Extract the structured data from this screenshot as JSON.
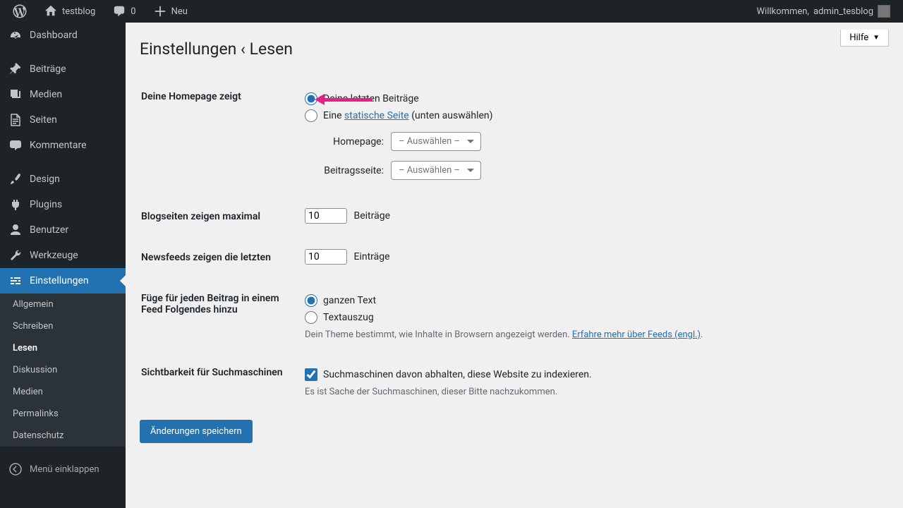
{
  "adminbar": {
    "site_name": "testblog",
    "comments_count": "0",
    "new_label": "Neu",
    "welcome_prefix": "Willkommen,",
    "username": "admin_tesblog"
  },
  "sidebar": {
    "items": [
      {
        "label": "Dashboard"
      },
      {
        "label": "Beiträge"
      },
      {
        "label": "Medien"
      },
      {
        "label": "Seiten"
      },
      {
        "label": "Kommentare"
      },
      {
        "label": "Design"
      },
      {
        "label": "Plugins"
      },
      {
        "label": "Benutzer"
      },
      {
        "label": "Werkzeuge"
      },
      {
        "label": "Einstellungen"
      }
    ],
    "submenu": [
      {
        "label": "Allgemein"
      },
      {
        "label": "Schreiben"
      },
      {
        "label": "Lesen"
      },
      {
        "label": "Diskussion"
      },
      {
        "label": "Medien"
      },
      {
        "label": "Permalinks"
      },
      {
        "label": "Datenschutz"
      }
    ],
    "collapse_label": "Menü einklappen"
  },
  "page": {
    "help_label": "Hilfe",
    "title": "Einstellungen ‹ Lesen",
    "homepage_label": "Deine Homepage zeigt",
    "homepage_opt1": "Deine letzten Beiträge",
    "homepage_opt2_pre": "Eine",
    "homepage_opt2_link": "statische Seite",
    "homepage_opt2_post": "(unten auswählen)",
    "homepage_select_label": "Homepage:",
    "posts_page_select_label": "Beitragsseite:",
    "select_placeholder": "– Auswählen –",
    "blog_pages_label": "Blogseiten zeigen maximal",
    "blog_pages_value": "10",
    "blog_pages_suffix": "Beiträge",
    "feed_items_label": "Newsfeeds zeigen die letzten",
    "feed_items_value": "10",
    "feed_items_suffix": "Einträge",
    "feed_content_label": "Füge für jeden Beitrag in einem Feed Folgendes hinzu",
    "feed_content_opt1": "ganzen Text",
    "feed_content_opt2": "Textauszug",
    "feed_desc_pre": "Dein Theme bestimmt, wie Inhalte in Browsern angezeigt werden.",
    "feed_desc_link": "Erfahre mehr über Feeds (engl.)",
    "visibility_label": "Sichtbarkeit für Suchmaschinen",
    "visibility_check": "Suchmaschinen davon abhalten, diese Website zu indexieren.",
    "visibility_desc": "Es ist Sache der Suchmaschinen, dieser Bitte nachzukommen.",
    "submit_label": "Änderungen speichern"
  }
}
